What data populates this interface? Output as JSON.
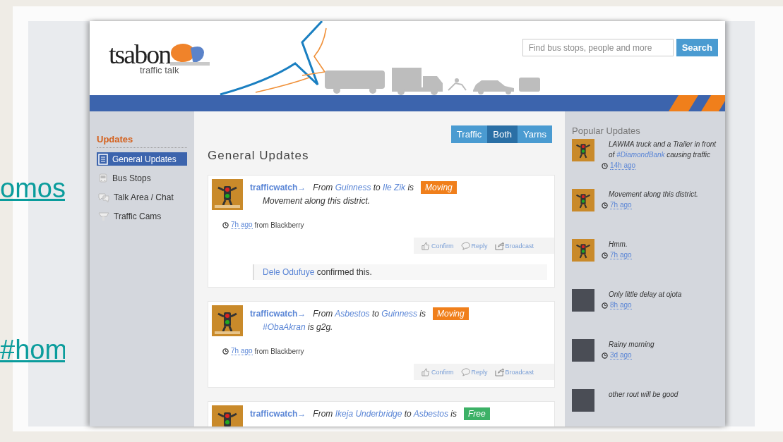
{
  "outer_links": [
    "omos",
    "#hom"
  ],
  "header": {
    "logo": "tsabon",
    "tagline": "traffic talk",
    "search": {
      "placeholder": "Find bus stops, people and more",
      "button": "Search"
    }
  },
  "sidebar": {
    "heading": "Updates",
    "items": [
      {
        "label": "General Updates",
        "selected": true
      },
      {
        "label": "Bus Stops",
        "selected": false
      },
      {
        "label": "Talk Area / Chat",
        "selected": false
      },
      {
        "label": "Traffic Cams",
        "selected": false
      }
    ]
  },
  "feed": {
    "title": "General Updates",
    "filters": [
      {
        "label": "Traffic",
        "selected": false
      },
      {
        "label": "Both",
        "selected": true
      },
      {
        "label": "Yarns",
        "selected": false
      }
    ],
    "posts": [
      {
        "author": "trafficwatch→",
        "route": {
          "from": "From",
          "origin": "Guinness",
          "to": "to",
          "destination": "Ile Zik",
          "is": "is"
        },
        "status": {
          "label": "Moving",
          "color": "#f07f1b"
        },
        "message": {
          "text": "Movement along this district."
        },
        "time": "7h ago",
        "source": "from Blackberry",
        "actions": [
          "Confirm",
          "Reply",
          "Broadcast"
        ],
        "confirmation": {
          "name": "Dele Odufuye",
          "text": "confirmed this."
        }
      },
      {
        "author": "trafficwatch→",
        "route": {
          "from": "From",
          "origin": "Asbestos",
          "to": "to",
          "destination": "Guinness",
          "is": "is"
        },
        "status": {
          "label": "Moving",
          "color": "#f07f1b"
        },
        "message": {
          "tag": "#ObaAkran",
          "text": "is g2g."
        },
        "time": "7h ago",
        "source": "from Blackberry",
        "actions": [
          "Confirm",
          "Reply",
          "Broadcast"
        ]
      },
      {
        "author": "trafficwatch→",
        "route": {
          "from": "From",
          "origin": "Ikeja Underbridge",
          "to": "to",
          "destination": "Asbestos",
          "is": "is"
        },
        "status": {
          "label": "Free",
          "color": "#3cb166"
        }
      }
    ]
  },
  "popular": {
    "title": "Popular Updates",
    "items": [
      {
        "kind": "logo",
        "text": "LAWMA truck and a Trailer in front of",
        "tag": "#DiamondBank",
        "text_after": "causing traffic",
        "time": "14h ago"
      },
      {
        "kind": "logo",
        "text": "Movement along this district.",
        "time": "7h ago"
      },
      {
        "kind": "logo",
        "text": "Hmm.",
        "time": "7h ago"
      },
      {
        "kind": "photo",
        "text": "Only little delay at ojota",
        "time": "8h ago"
      },
      {
        "kind": "photo",
        "text": "Rainy morning",
        "time": "3d ago"
      },
      {
        "kind": "photo",
        "text": "other rout will be good"
      }
    ]
  }
}
